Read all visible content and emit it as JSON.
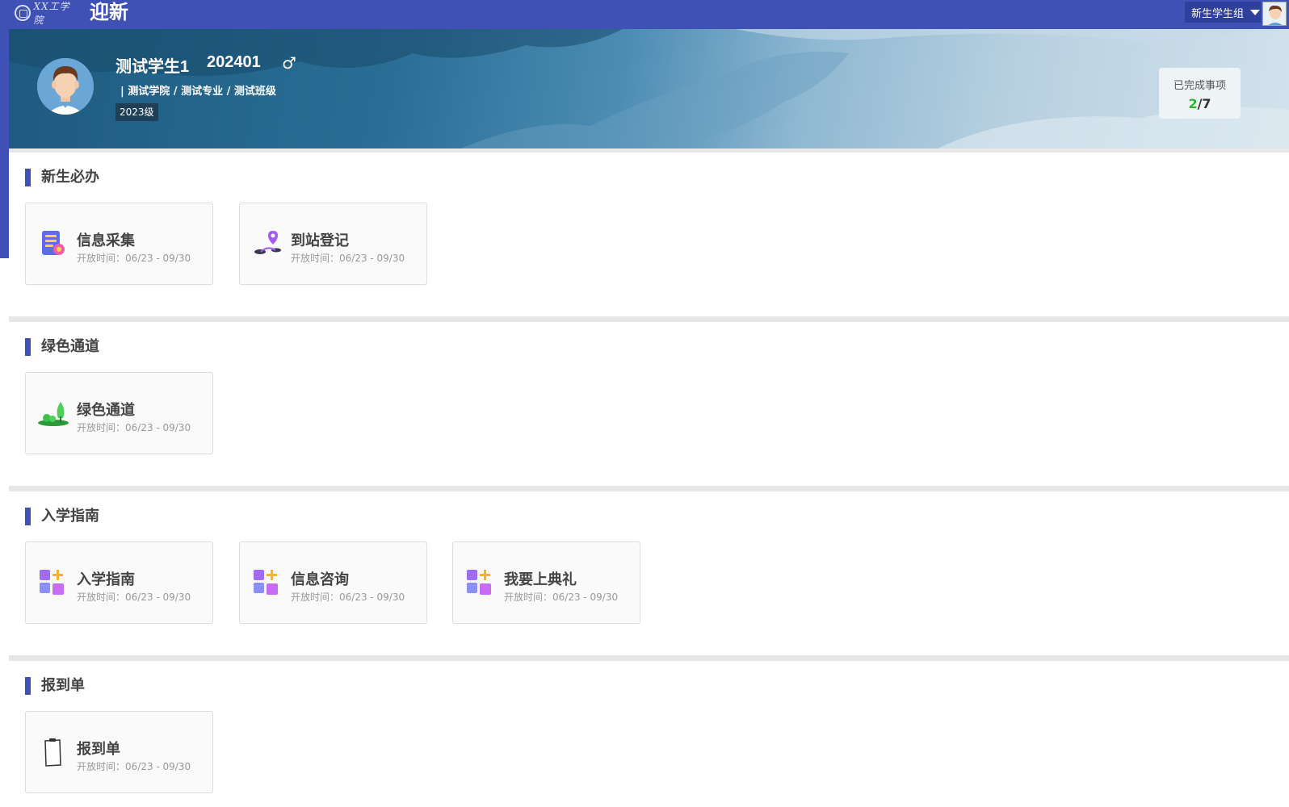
{
  "header": {
    "logo_text": "XX工学院",
    "app_title": "迎新",
    "role_selected": "新生学生组"
  },
  "profile": {
    "name": "测试学生1",
    "student_id": "202401",
    "gender_symbol": "♂",
    "path": "| 测试学院 / 测试专业 / 测试班级",
    "grade": "2023级"
  },
  "progress": {
    "label": "已完成事项",
    "done": "2",
    "separator": "/",
    "total": "7",
    "done_color": "#2eb82e"
  },
  "accent_color": "#3f51b5",
  "sections": [
    {
      "title": "新生必办",
      "cards": [
        {
          "title": "信息采集",
          "time": "开放时间：06/23 - 09/30",
          "icon": "clipboard-checklist-icon"
        },
        {
          "title": "到站登记",
          "time": "开放时间：06/23 - 09/30",
          "icon": "map-pin-route-icon"
        }
      ]
    },
    {
      "title": "绿色通道",
      "cards": [
        {
          "title": "绿色通道",
          "time": "开放时间：06/23 - 09/30",
          "icon": "trees-icon"
        }
      ]
    },
    {
      "title": "入学指南",
      "cards": [
        {
          "title": "入学指南",
          "time": "开放时间：06/23 - 09/30",
          "icon": "app-grid-plus-icon"
        },
        {
          "title": "信息咨询",
          "time": "开放时间：06/23 - 09/30",
          "icon": "app-grid-plus-icon"
        },
        {
          "title": "我要上典礼",
          "time": "开放时间：06/23 - 09/30",
          "icon": "app-grid-plus-icon"
        }
      ]
    },
    {
      "title": "报到单",
      "cards": [
        {
          "title": "报到单",
          "time": "开放时间：06/23 - 09/30",
          "icon": "clipboard-icon"
        }
      ]
    }
  ]
}
